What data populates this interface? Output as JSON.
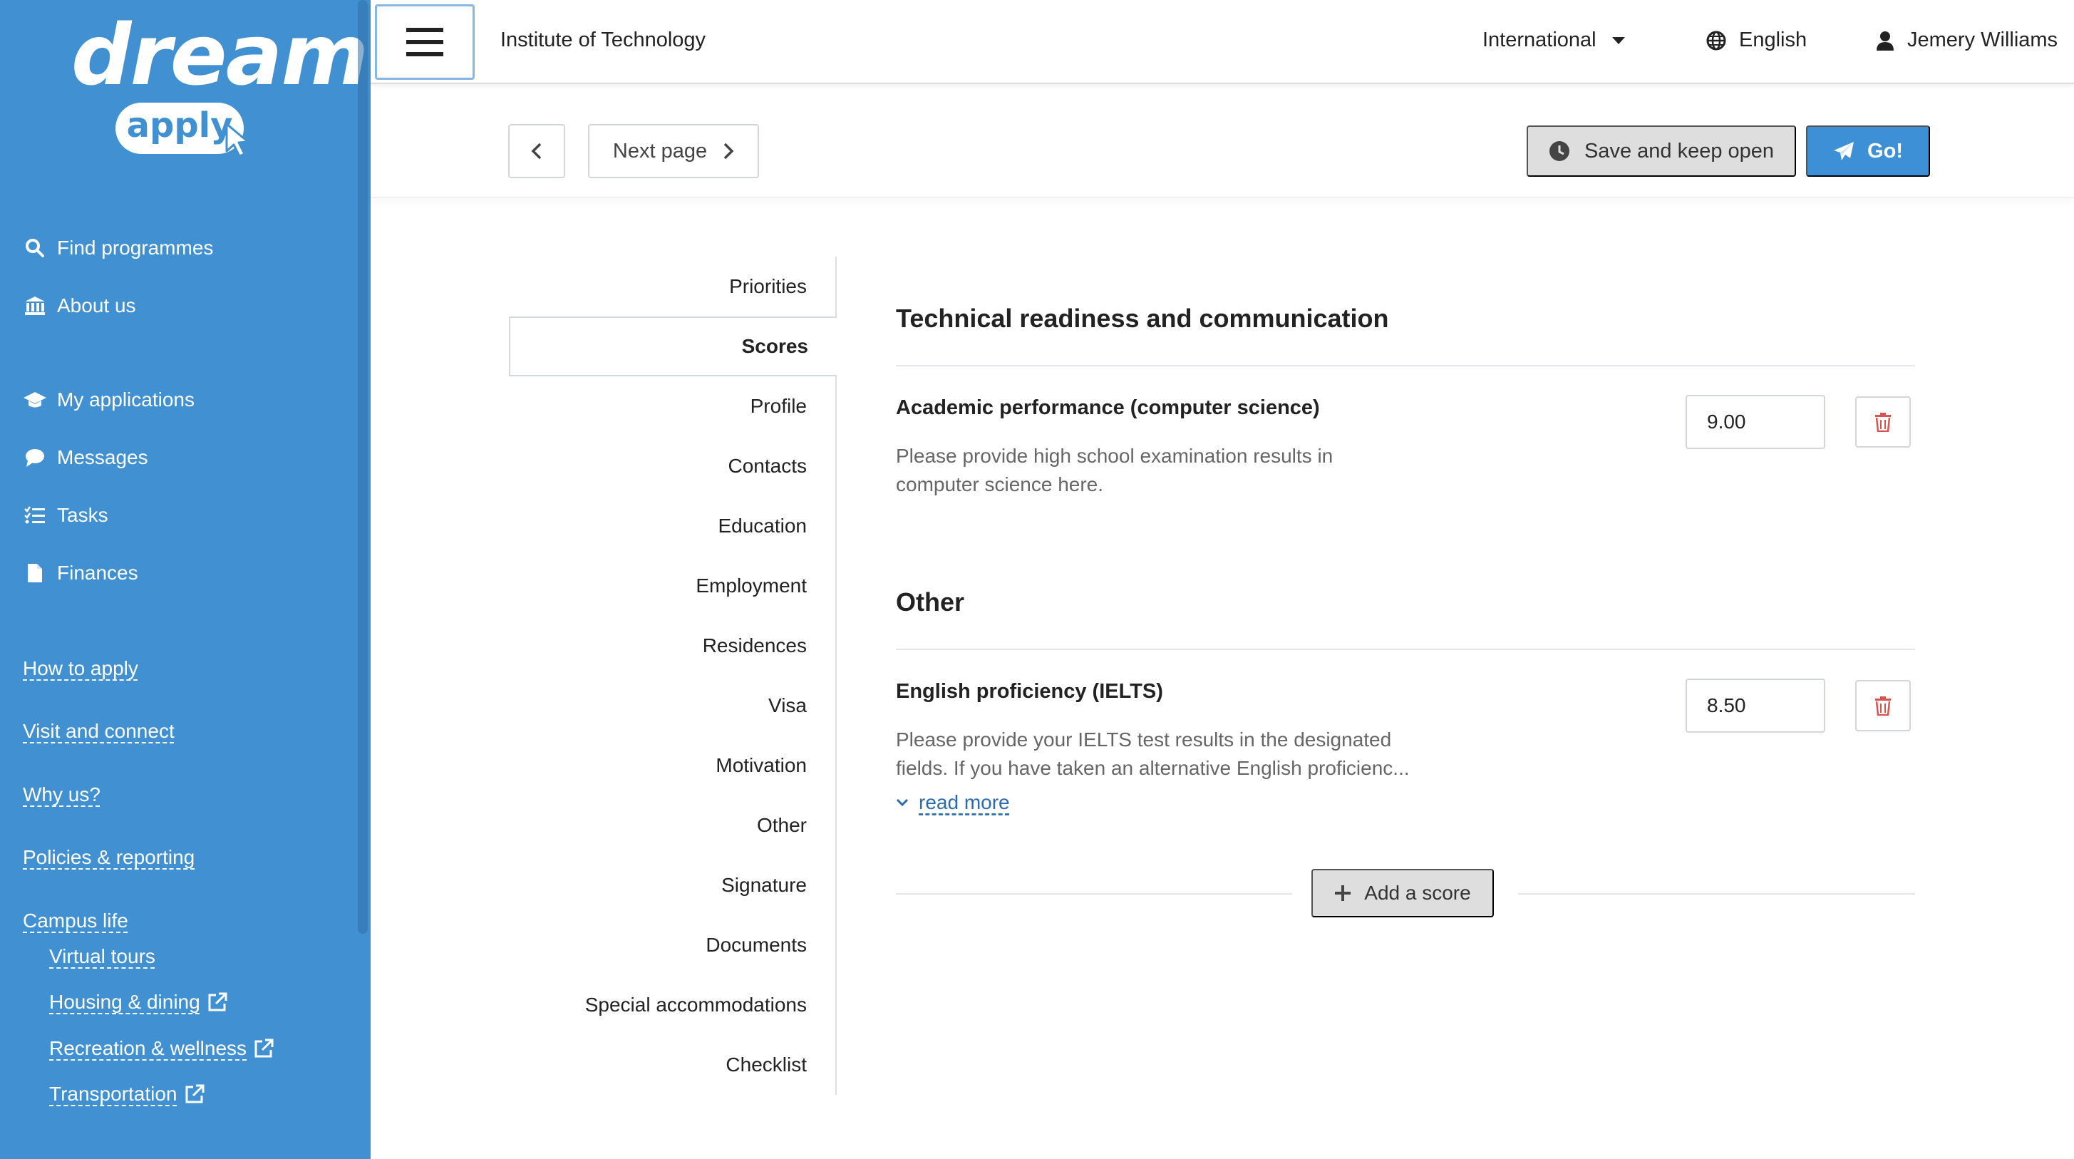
{
  "brand": {
    "logo_word": "dream",
    "logo_sub": "apply"
  },
  "sidebar": {
    "primary": [
      {
        "label": "Find programmes",
        "icon": "search-icon"
      },
      {
        "label": "About us",
        "icon": "institution-icon"
      }
    ],
    "account": [
      {
        "label": "My applications",
        "icon": "graduation-cap-icon"
      },
      {
        "label": "Messages",
        "icon": "speech-bubble-icon"
      },
      {
        "label": "Tasks",
        "icon": "task-list-icon"
      },
      {
        "label": "Finances",
        "icon": "document-icon"
      }
    ],
    "links": [
      {
        "label": "How to apply"
      },
      {
        "label": "Visit and connect"
      },
      {
        "label": "Why us?"
      },
      {
        "label": "Policies & reporting"
      },
      {
        "label": "Campus life"
      }
    ],
    "sublinks": [
      {
        "label": "Virtual tours",
        "external": false
      },
      {
        "label": "Housing & dining",
        "external": true
      },
      {
        "label": "Recreation & wellness",
        "external": true
      },
      {
        "label": "Transportation",
        "external": true
      }
    ]
  },
  "header": {
    "institution": "Institute of Technology",
    "region": "International",
    "language": "English",
    "user": "Jemery Williams"
  },
  "toolbar": {
    "next_label": "Next page",
    "save_label": "Save and keep open",
    "go_label": "Go!"
  },
  "section_nav": {
    "items": [
      "Priorities",
      "Scores",
      "Profile",
      "Contacts",
      "Education",
      "Employment",
      "Residences",
      "Visa",
      "Motivation",
      "Other",
      "Signature",
      "Documents",
      "Special accommodations",
      "Checklist"
    ],
    "active": "Scores"
  },
  "content": {
    "sections": [
      {
        "title": "Technical readiness and communication",
        "score": {
          "name": "Academic performance (computer science)",
          "desc_line1": "Please provide high school examination results in",
          "desc_line2": "computer science here.",
          "value": "9.00"
        }
      },
      {
        "title": "Other",
        "score": {
          "name": "English proficiency (IELTS)",
          "desc_line1": "Please provide your IELTS test results in the designated",
          "desc_line2": "fields. If you have taken an alternative English proficienc...",
          "value": "8.50",
          "read_more": "read more"
        }
      }
    ],
    "add_label": "Add a score"
  },
  "colors": {
    "sidebar_bg": "#4090d2",
    "primary_button": "#3d8fd6",
    "delete_icon": "#d9534f",
    "link": "#2b6cb0"
  }
}
